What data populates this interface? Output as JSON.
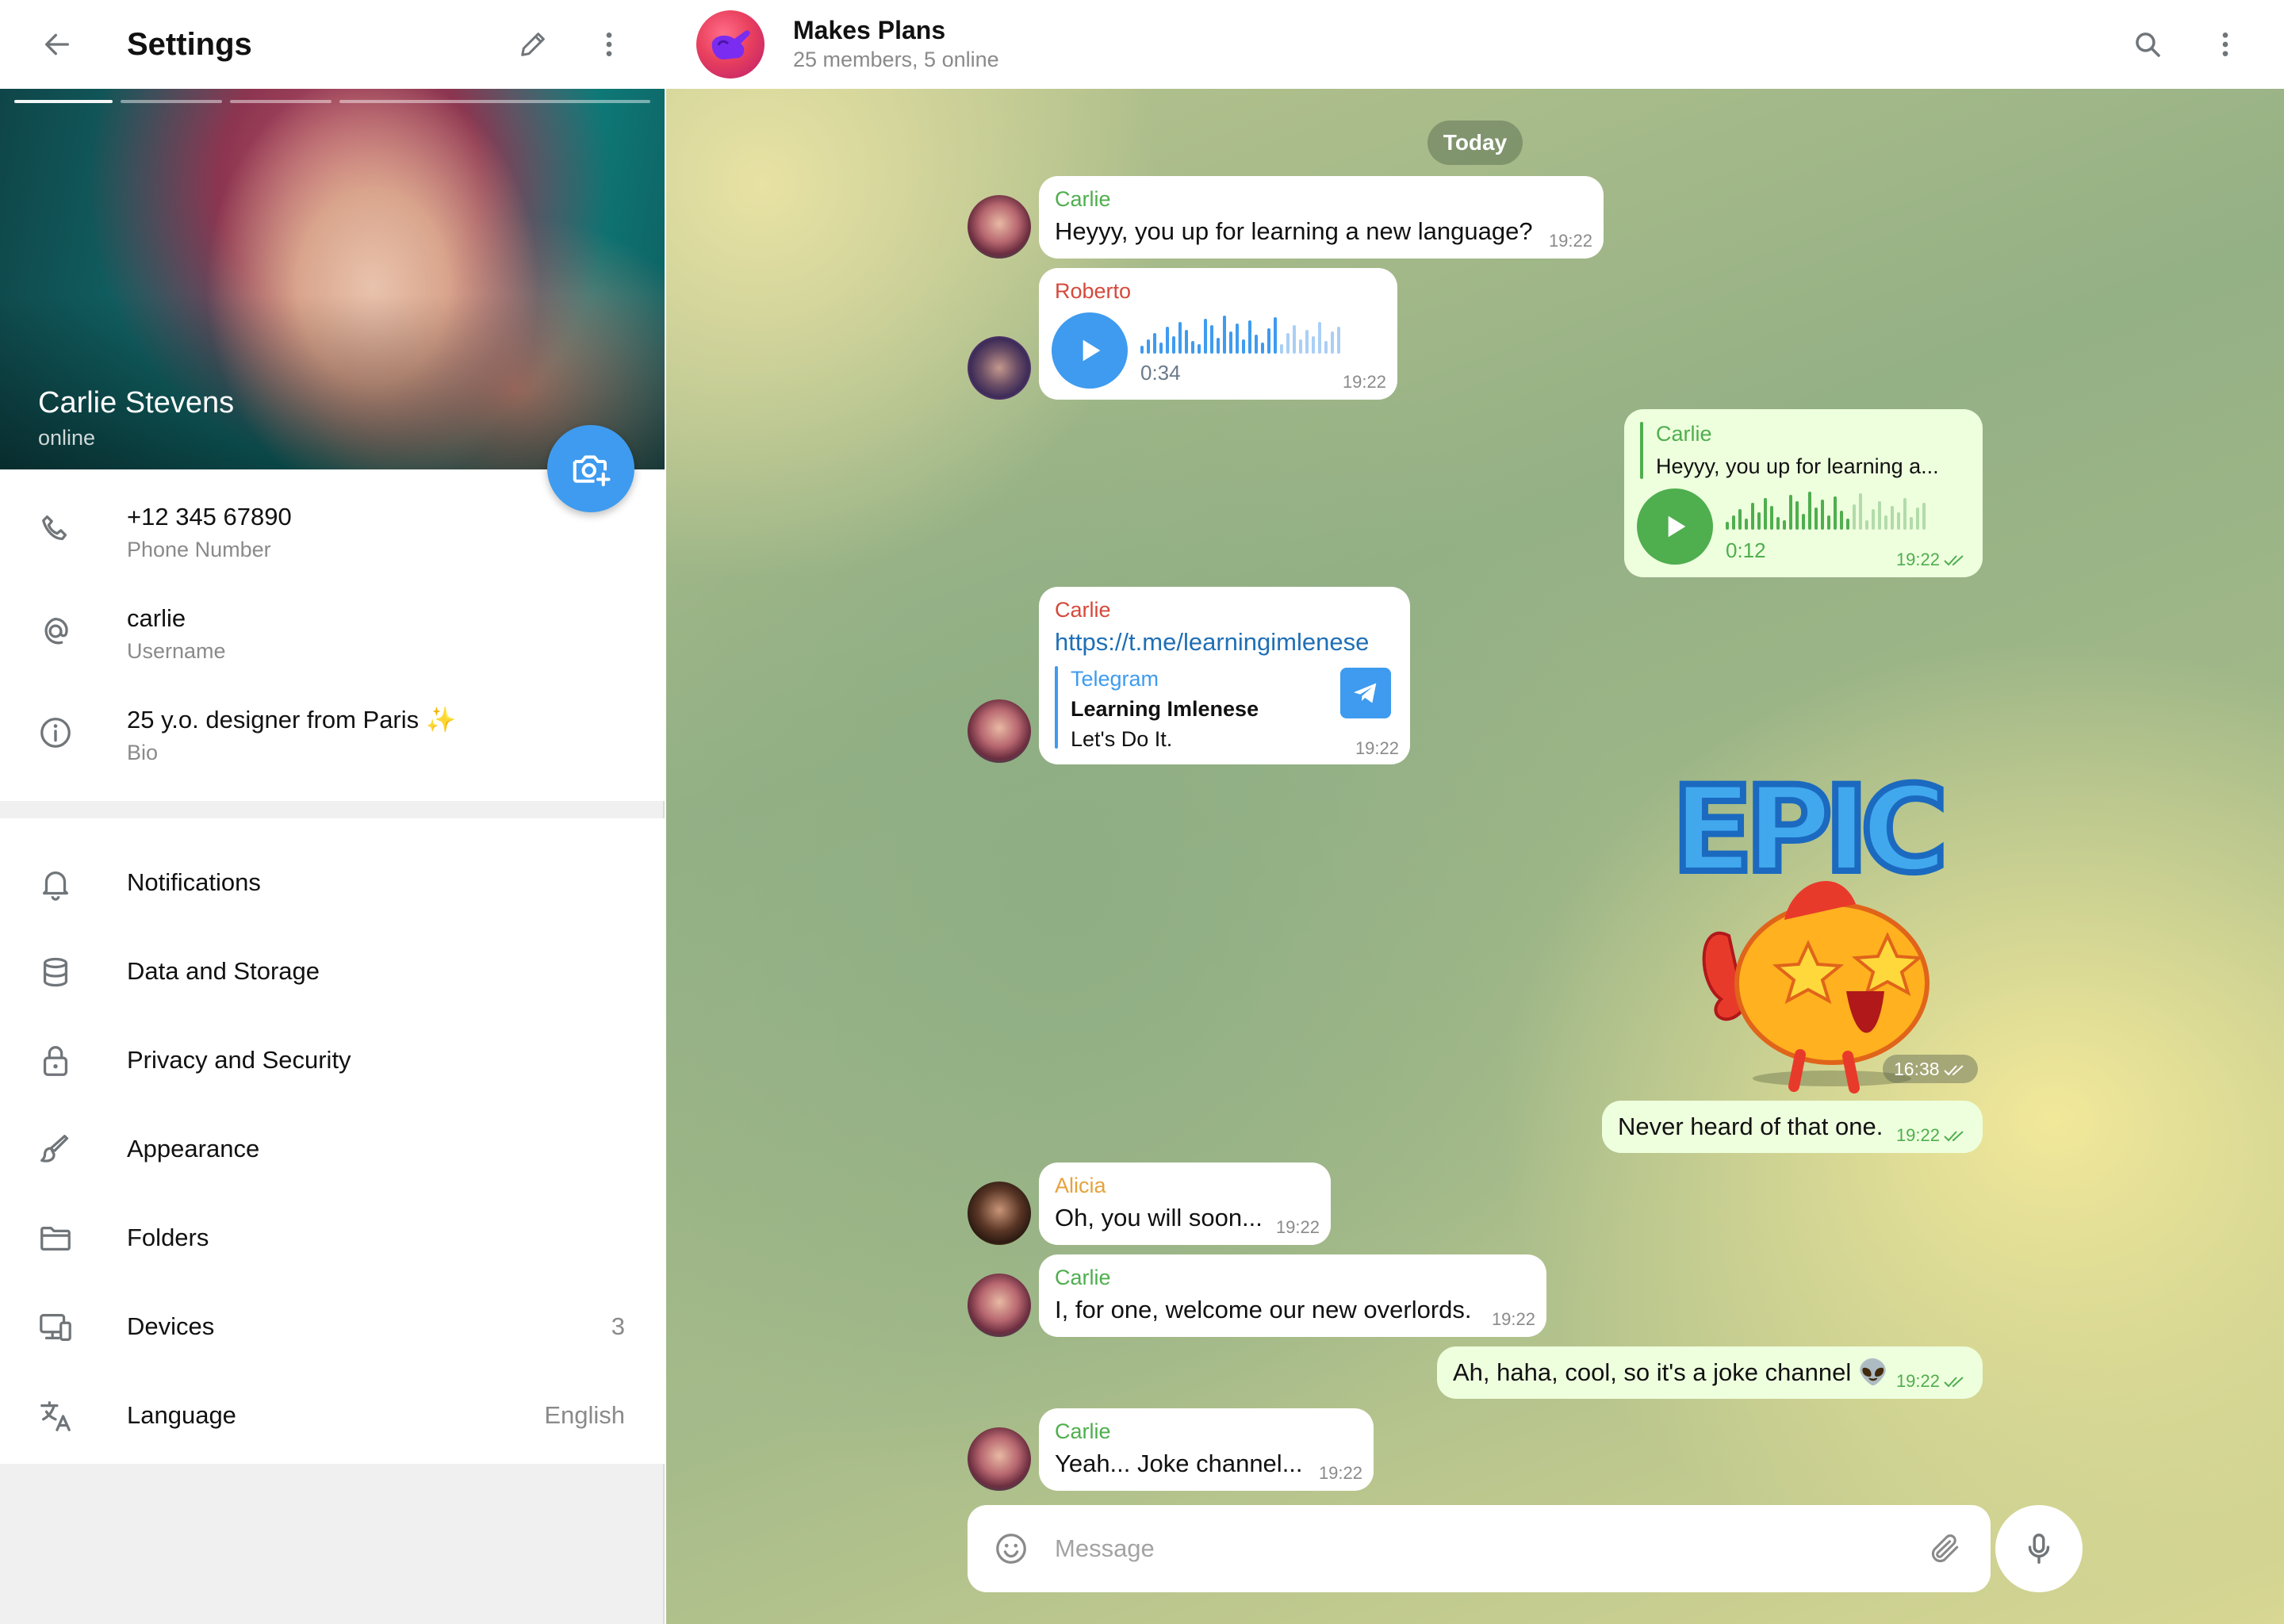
{
  "settings": {
    "title": "Settings",
    "profile": {
      "name": "Carlie Stevens",
      "status": "online"
    },
    "info": [
      {
        "value": "+12 345 67890",
        "label": "Phone Number",
        "icon": "phone-icon"
      },
      {
        "value": "carlie",
        "label": "Username",
        "icon": "at-icon"
      },
      {
        "value": "25 y.o. designer from Paris ✨",
        "label": "Bio",
        "icon": "info-icon"
      }
    ],
    "menu": [
      {
        "label": "Notifications",
        "value": "",
        "icon": "bell-icon"
      },
      {
        "label": "Data and Storage",
        "value": "",
        "icon": "database-icon"
      },
      {
        "label": "Privacy and Security",
        "value": "",
        "icon": "lock-icon"
      },
      {
        "label": "Appearance",
        "value": "",
        "icon": "brush-icon"
      },
      {
        "label": "Folders",
        "value": "",
        "icon": "folder-icon"
      },
      {
        "label": "Devices",
        "value": "3",
        "icon": "devices-icon"
      },
      {
        "label": "Language",
        "value": "English",
        "icon": "translate-icon"
      }
    ]
  },
  "chat": {
    "title": "Makes Plans",
    "subtitle": "25 members, 5 online",
    "date_divider": "Today",
    "messages": [
      {
        "sender": "Carlie",
        "text": "Heyyy, you up for learning a new language?",
        "time": "19:22"
      },
      {
        "sender": "Roberto",
        "duration": "0:34",
        "time": "19:22"
      },
      {
        "reply_sender": "Carlie",
        "reply_text": "Heyyy, you up for learning a...",
        "duration": "0:12",
        "time": "19:22"
      },
      {
        "sender": "Carlie",
        "link": "https://t.me/learningimlenese",
        "preview_site": "Telegram",
        "preview_title": "Learning Imlenese",
        "preview_desc": "Let's Do It.",
        "time": "19:22"
      },
      {
        "sticker_text": "EPIC",
        "time": "16:38"
      },
      {
        "text": "Never heard of that one.",
        "time": "19:22"
      },
      {
        "sender": "Alicia",
        "text": "Oh, you will soon...",
        "time": "19:22"
      },
      {
        "sender": "Carlie",
        "text": "I, for one, welcome our new overlords.",
        "time": "19:22"
      },
      {
        "text": "Ah, haha, cool, so it's a joke channel 👽",
        "time": "19:22"
      },
      {
        "sender": "Carlie",
        "text": "Yeah... Joke channel...",
        "time": "19:22"
      }
    ],
    "composer_placeholder": "Message"
  },
  "colors": {
    "accent": "#3e9bef",
    "sender_carlie": "#4fae4e",
    "sender_roberto": "#d5493b",
    "sender_alicia": "#e6a23c",
    "outgoing_bubble": "#eeffde",
    "link": "#1f6fb5"
  }
}
